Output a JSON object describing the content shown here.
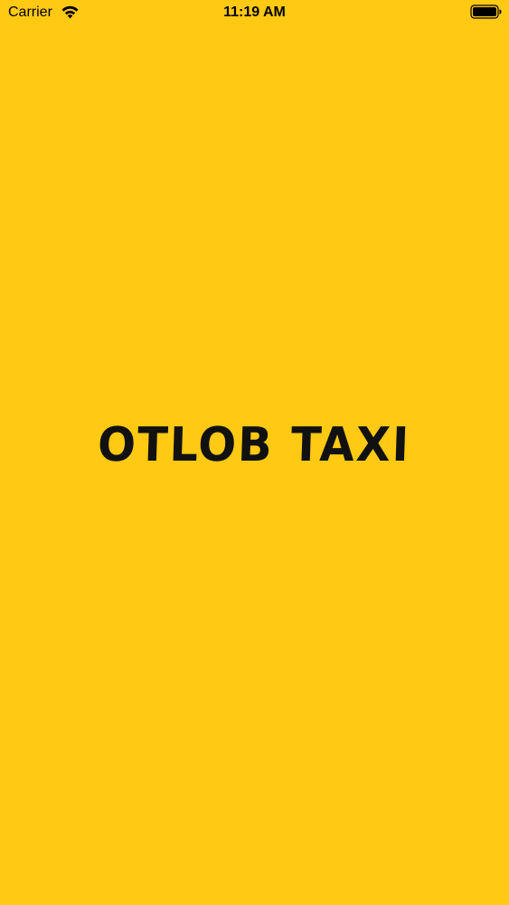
{
  "status_bar": {
    "carrier": "Carrier",
    "time": "11:19 AM",
    "wifi_icon": "wifi-icon",
    "battery_icon": "battery-full-icon"
  },
  "splash": {
    "title": "OTLOB TAXI"
  },
  "colors": {
    "background": "#FFC914",
    "title": "#111111"
  }
}
